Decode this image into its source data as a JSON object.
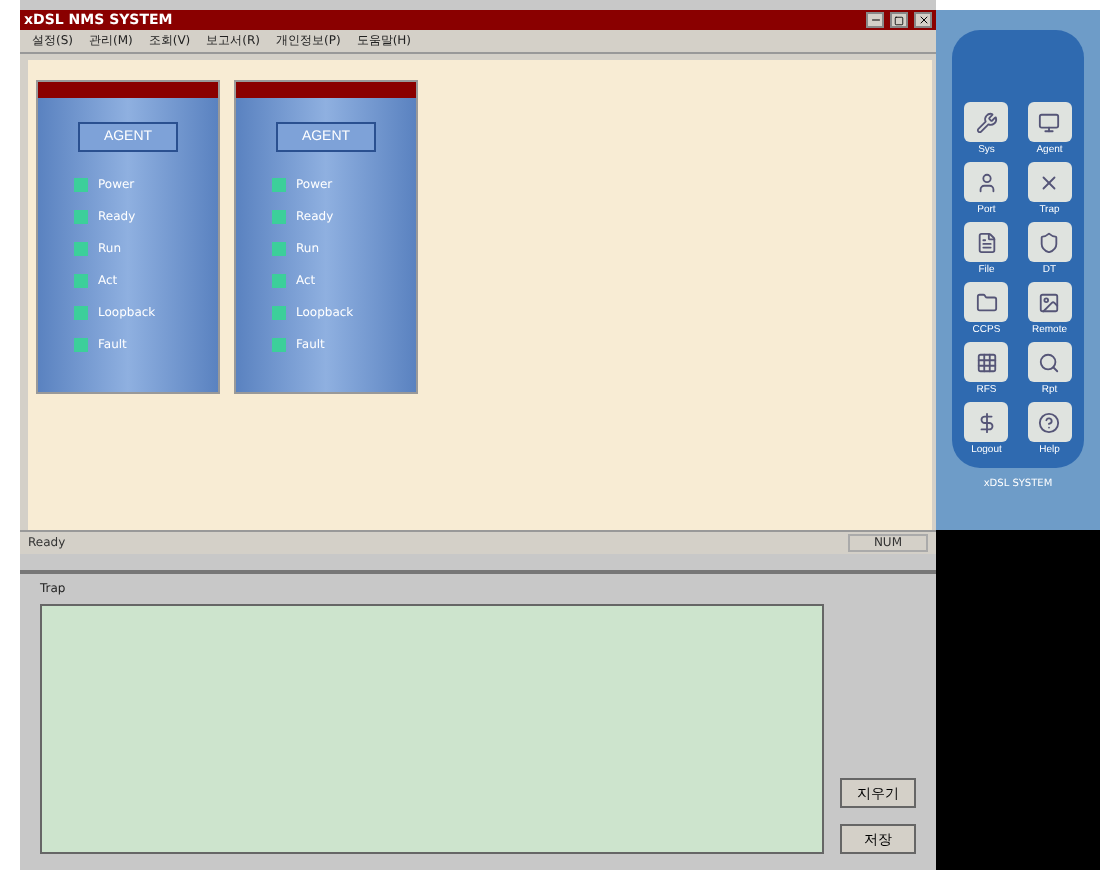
{
  "window": {
    "title": "xDSL NMS SYSTEM"
  },
  "menu": [
    "설정(S)",
    "관리(M)",
    "조회(V)",
    "보고서(R)",
    "개인정보(P)",
    "도움말(H)"
  ],
  "agents": [
    {
      "name": "AGENT",
      "leds": [
        {
          "label": "Power",
          "on": true
        },
        {
          "label": "Ready",
          "on": true
        },
        {
          "label": "Run",
          "on": true
        },
        {
          "label": "Act",
          "on": true
        },
        {
          "label": "Loopback",
          "on": true
        },
        {
          "label": "Fault",
          "on": true
        }
      ]
    },
    {
      "name": "AGENT",
      "leds": [
        {
          "label": "Power",
          "on": true
        },
        {
          "label": "Ready",
          "on": true
        },
        {
          "label": "Run",
          "on": true
        },
        {
          "label": "Act",
          "on": true
        },
        {
          "label": "Loopback",
          "on": true
        },
        {
          "label": "Fault",
          "on": true
        }
      ]
    }
  ],
  "status_bar": {
    "left": "Ready",
    "right": "NUM"
  },
  "trap": {
    "title": "Trap",
    "buttons": [
      "지우기",
      "저장"
    ]
  },
  "toolbar": {
    "items": [
      {
        "label": "Sys"
      },
      {
        "label": "Agent"
      },
      {
        "label": "Port"
      },
      {
        "label": "Trap"
      },
      {
        "label": "File"
      },
      {
        "label": "DT"
      },
      {
        "label": "CCPS"
      },
      {
        "label": "Remote"
      },
      {
        "label": "RFS"
      },
      {
        "label": "Rpt"
      },
      {
        "label": "Logout"
      },
      {
        "label": "Help"
      }
    ],
    "footer": "xDSL SYSTEM"
  }
}
